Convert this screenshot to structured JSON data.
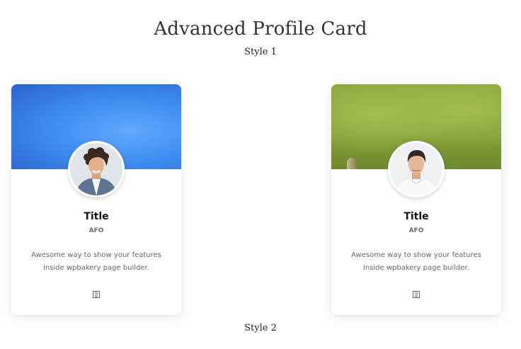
{
  "page": {
    "title": "Advanced Profile Card",
    "style_one_label": "Style 1",
    "style_two_label": "Style 2"
  },
  "cards": [
    {
      "cover_color": "#3f8ef2",
      "title": "Title",
      "subtitle": "AFO",
      "description": "Awesome way to show your features inside wpbakery page builder.",
      "social_icon": "missing-glyph-icon"
    },
    {
      "cover_color": "#84a03a",
      "title": "Title",
      "subtitle": "AFO",
      "description": "Awesome way to show your features inside wpbakery page builder.",
      "social_icon": "missing-glyph-icon"
    }
  ],
  "colors": {
    "title_text": "#151515",
    "subtitle_text": "#6a6a6a",
    "description_text": "#666666"
  }
}
